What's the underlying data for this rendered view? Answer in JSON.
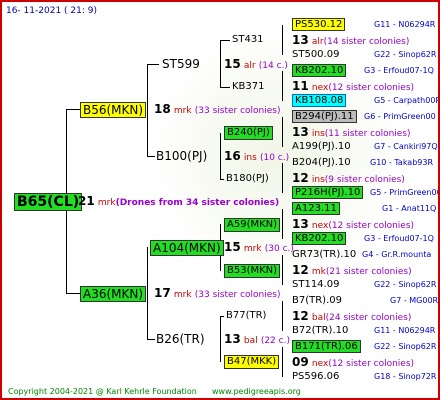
{
  "header": {
    "date": "16- 11-2021 ( 21:  9)"
  },
  "footer": {
    "copyright": "Copyright 2004-2021 @ Karl Kehrle Foundation",
    "website": "www.pedigreeapis.org"
  },
  "root": {
    "label": "B65(CL)",
    "gen": "21",
    "mark": "mrk",
    "note": "(Drones from 34 sister colonies)"
  },
  "gen1": [
    {
      "label": "B56(MKN)",
      "num": "18",
      "mark": "mrk",
      "count": "(33 sister colonies)"
    },
    {
      "label": "A36(MKN)",
      "num": "17",
      "mark": "mrk",
      "count": "(33 sister colonies)"
    }
  ],
  "gen2": [
    {
      "label": "ST599",
      "num": "15",
      "mark": "alr",
      "count": "(14 c.)"
    },
    {
      "label": "B100(PJ)",
      "num": "16",
      "mark": "ins",
      "count": "(10 c.)"
    },
    {
      "label": "A104(MKN)",
      "num": "15",
      "mark": "mrk",
      "count": "(30 c.)"
    },
    {
      "label": "B26(TR)",
      "num": "13",
      "mark": "bal",
      "count": "(22 c.)"
    }
  ],
  "gen3": [
    {
      "label": "ST431"
    },
    {
      "label": "KB371"
    },
    {
      "label": "B240(PJ)"
    },
    {
      "label": "B180(PJ)"
    },
    {
      "label": "A59(MKN)"
    },
    {
      "label": "B53(MKN)"
    },
    {
      "label": "B77(TR)"
    },
    {
      "label": "B47(MKK)"
    }
  ],
  "gen4": [
    {
      "label": "PS530.12",
      "src": "G11 - N06294R"
    },
    {
      "num": "13",
      "mark": "alr",
      "count": "(14 sister colonies)"
    },
    {
      "label": "ST500.09",
      "src": "G22 - Sinop62R"
    },
    {
      "label": "KB202.10",
      "src": "G3 - Erfoud07-1Q"
    },
    {
      "num": "11",
      "mark": "nex",
      "count": "(12 sister colonies)"
    },
    {
      "label": "KB108.08",
      "src": "G5 - Carpath00R"
    },
    {
      "label": "B294(PJ).11",
      "src": "G6 - PrimGreen00"
    },
    {
      "num": "13",
      "mark": "ins",
      "count": "(11 sister colonies)"
    },
    {
      "label": "A199(PJ).10",
      "src": "G7 - Cankiri97Q"
    },
    {
      "label": "B204(PJ).10",
      "src": "G10 - Takab93R"
    },
    {
      "num": "12",
      "mark": "ins",
      "count": "(9 sister colonies)"
    },
    {
      "label": "P216H(PJ).10",
      "src": "G5 - PrimGreen00"
    },
    {
      "label": "A123.11",
      "src": "G1 - Anat11Q"
    },
    {
      "num": "13",
      "mark": "nex",
      "count": "(12 sister colonies)"
    },
    {
      "label": "KB202.10",
      "src": "G3 - Erfoud07-1Q"
    },
    {
      "label": "GR73(TR).10",
      "src": "G4 - Gr.R.mounta"
    },
    {
      "num": "12",
      "mark": "mk",
      "count": "(21 sister colonies)"
    },
    {
      "label": "ST114.09",
      "src": "G22 - Sinop62R"
    },
    {
      "label": "B7(TR).09",
      "src": "G7 - MG00R"
    },
    {
      "num": "12",
      "mark": "bal",
      "count": "(24 sister colonies)"
    },
    {
      "label": "B72(TR).10",
      "src": "G11 - N06294R"
    },
    {
      "label": "B171(TR).06",
      "src": "G22 - Sinop62R"
    },
    {
      "num": "09",
      "mark": "nex",
      "count": "(12 sister colonies)"
    },
    {
      "label": "PS596.06",
      "src": "G18 - Sinop72R"
    }
  ]
}
